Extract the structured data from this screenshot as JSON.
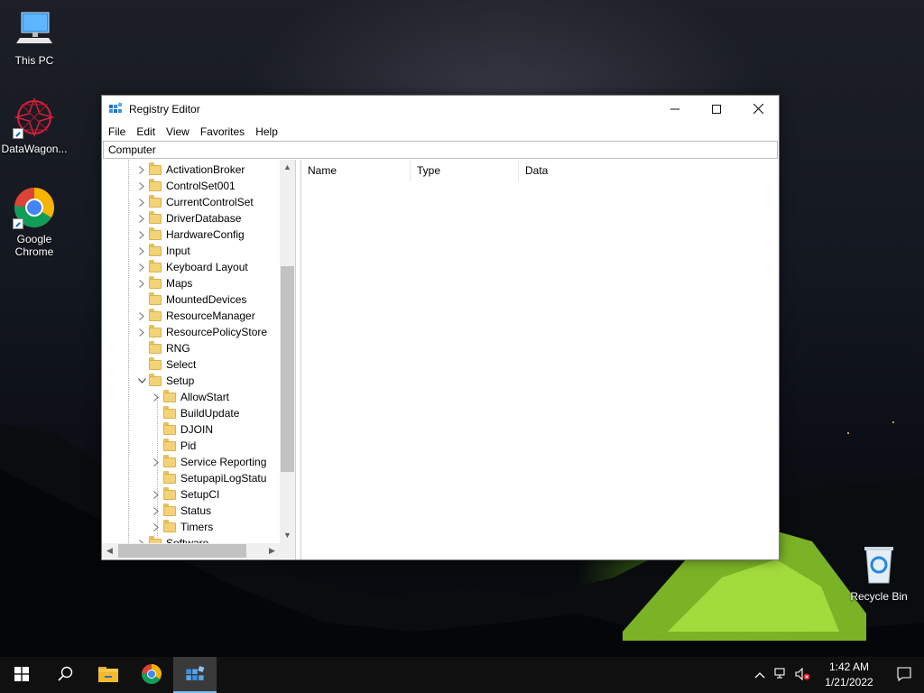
{
  "desktop": {
    "icons": [
      {
        "label": "This PC",
        "icon": "computer-icon"
      },
      {
        "label": "DataWagon...",
        "icon": "datawagon-icon"
      },
      {
        "label": "Google Chrome",
        "icon": "chrome-icon"
      },
      {
        "label": "Recycle Bin",
        "icon": "recycle-bin-icon"
      }
    ]
  },
  "window": {
    "title": "Registry Editor",
    "controls": {
      "minimize": "—",
      "maximize": "☐",
      "close": "✕"
    },
    "menu": [
      "File",
      "Edit",
      "View",
      "Favorites",
      "Help"
    ],
    "address": "Computer",
    "tree": [
      {
        "label": "ActivationBroker",
        "expandable": true
      },
      {
        "label": "ControlSet001",
        "expandable": true
      },
      {
        "label": "CurrentControlSet",
        "expandable": true
      },
      {
        "label": "DriverDatabase",
        "expandable": true
      },
      {
        "label": "HardwareConfig",
        "expandable": true
      },
      {
        "label": "Input",
        "expandable": true
      },
      {
        "label": "Keyboard Layout",
        "expandable": true
      },
      {
        "label": "Maps",
        "expandable": true
      },
      {
        "label": "MountedDevices",
        "expandable": false
      },
      {
        "label": "ResourceManager",
        "expandable": true
      },
      {
        "label": "ResourcePolicyStore",
        "expandable": true
      },
      {
        "label": "RNG",
        "expandable": false
      },
      {
        "label": "Select",
        "expandable": false
      },
      {
        "label": "Setup",
        "expandable": true,
        "expanded": true
      },
      {
        "label": "AllowStart",
        "expandable": true,
        "child": true
      },
      {
        "label": "BuildUpdate",
        "expandable": false,
        "child": true
      },
      {
        "label": "DJOIN",
        "expandable": false,
        "child": true
      },
      {
        "label": "Pid",
        "expandable": false,
        "child": true
      },
      {
        "label": "Service Reporting",
        "expandable": true,
        "child": true
      },
      {
        "label": "SetupapiLogStatu",
        "expandable": false,
        "child": true
      },
      {
        "label": "SetupCI",
        "expandable": true,
        "child": true
      },
      {
        "label": "Status",
        "expandable": true,
        "child": true
      },
      {
        "label": "Timers",
        "expandable": true,
        "child": true
      },
      {
        "label": "Software",
        "expandable": true
      }
    ],
    "columns": [
      "Name",
      "Type",
      "Data"
    ]
  },
  "taskbar": {
    "items": [
      {
        "name": "start-button",
        "icon": "windows-logo-icon"
      },
      {
        "name": "search-button",
        "icon": "search-icon"
      },
      {
        "name": "file-explorer-button",
        "icon": "folder-icon"
      },
      {
        "name": "chrome-button",
        "icon": "chrome-icon"
      },
      {
        "name": "registry-editor-button",
        "icon": "regedit-icon",
        "active": true
      }
    ],
    "tray": {
      "chevron": "^",
      "time": "1:42 AM",
      "date": "1/21/2022"
    }
  }
}
